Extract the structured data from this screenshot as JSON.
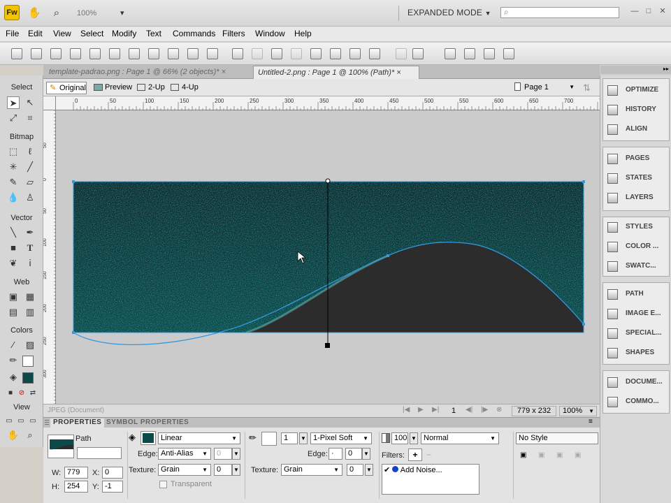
{
  "app": {
    "logo": "Fw",
    "zoom": "100%",
    "mode": "EXPANDED MODE"
  },
  "menu": [
    "File",
    "Edit",
    "View",
    "Select",
    "Modify",
    "Text",
    "Commands",
    "Filters",
    "Window",
    "Help"
  ],
  "tools": {
    "select": "Select",
    "bitmap": "Bitmap",
    "vector": "Vector",
    "web": "Web",
    "colors": "Colors",
    "view": "View"
  },
  "tabs": [
    {
      "label": "template-padrao.png : Page 1 @ 66% (2 objects)*",
      "close": "×"
    },
    {
      "label": "Untitled-2.png : Page 1 @ 100% (Path)*",
      "close": "×"
    }
  ],
  "views": {
    "original": "Original",
    "preview": "Preview",
    "two_up": "2-Up",
    "four_up": "4-Up",
    "page": "Page 1"
  },
  "ruler_h": [
    "0",
    "50",
    "100",
    "150",
    "200",
    "250",
    "300",
    "350",
    "400",
    "450",
    "500",
    "550",
    "600",
    "650",
    "700",
    "750"
  ],
  "ruler_v": [
    "50",
    "0",
    "50",
    "100",
    "150",
    "200",
    "250",
    "300"
  ],
  "status": {
    "doc_type": "JPEG (Document)",
    "frame": "1",
    "size": "779 x 232",
    "zoom": "100%"
  },
  "props_tabs": {
    "properties": "PROPERTIES",
    "symbol": "SYMBOL PROPERTIES"
  },
  "props": {
    "object_type": "Path",
    "fill_type": "Linear",
    "edge_label": "Edge:",
    "edge": "Anti-Alias",
    "edge_amount": "0",
    "texture_label": "Texture:",
    "texture": "Grain",
    "texture_amount": "0",
    "transparent": "Transparent",
    "stroke_size": "1",
    "stroke_type": "1-Pixel Soft",
    "stroke_edge_label": "Edge:",
    "stroke_edge": "0",
    "stroke_texture_label": "Texture:",
    "stroke_texture": "Grain",
    "stroke_texture_amount": "0",
    "opacity": "100",
    "blend": "Normal",
    "filters_label": "Filters:",
    "filter_item": "Add Noise...",
    "style": "No Style",
    "w_label": "W:",
    "w": "779",
    "h_label": "H:",
    "h": "254",
    "x_label": "X:",
    "x": "0",
    "y_label": "Y:",
    "y": "-1"
  },
  "panels": [
    "OPTIMIZE",
    "HISTORY",
    "ALIGN",
    "PAGES",
    "STATES",
    "LAYERS",
    "STYLES",
    "COLOR ...",
    "SWATC...",
    "PATH",
    "IMAGE E...",
    "SPECIAL...",
    "SHAPES",
    "DOCUME...",
    "COMMO..."
  ],
  "colors": {
    "teal_fill": "#0c4a4a",
    "dark_fill": "#2c2c2c",
    "path_blue": "#3399dd"
  }
}
